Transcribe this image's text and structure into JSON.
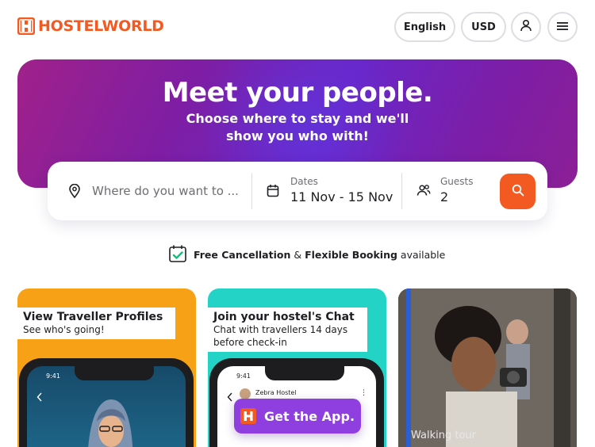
{
  "header": {
    "logo_text": "HOSTELWORLD",
    "language_label": "English",
    "currency_label": "USD",
    "icons": {
      "user": "user-icon",
      "menu": "hamburger-menu-icon"
    }
  },
  "hero": {
    "title": "Meet your people.",
    "subtitle": "Choose where to stay and we'll show you who with!"
  },
  "search": {
    "where_placeholder": "Where do you want to ...",
    "dates_label": "Dates",
    "dates_value": "11 Nov - 15 Nov",
    "guests_label": "Guests",
    "guests_value": "2"
  },
  "cancellation": {
    "part1": "Free Cancellation",
    "amp": "&",
    "part2": "Flexible Booking",
    "part3": "available"
  },
  "cards": [
    {
      "title": "View Traveller Profiles",
      "subtitle": "See who's going!",
      "phone_time": "9:41"
    },
    {
      "title": "Join your hostel's Chat",
      "subtitle": "Chat with travellers 14 days before check-in",
      "phone_time": "9:41",
      "chat_name": "Zebra Hostel"
    },
    {
      "overlay_text": "Walking tour"
    }
  ],
  "app_cta": {
    "label": "Get the App."
  },
  "colors": {
    "brand_orange": "#f25a22",
    "hero_purple": "#7e1ea4",
    "cta_purple": "#8f3fe0"
  }
}
